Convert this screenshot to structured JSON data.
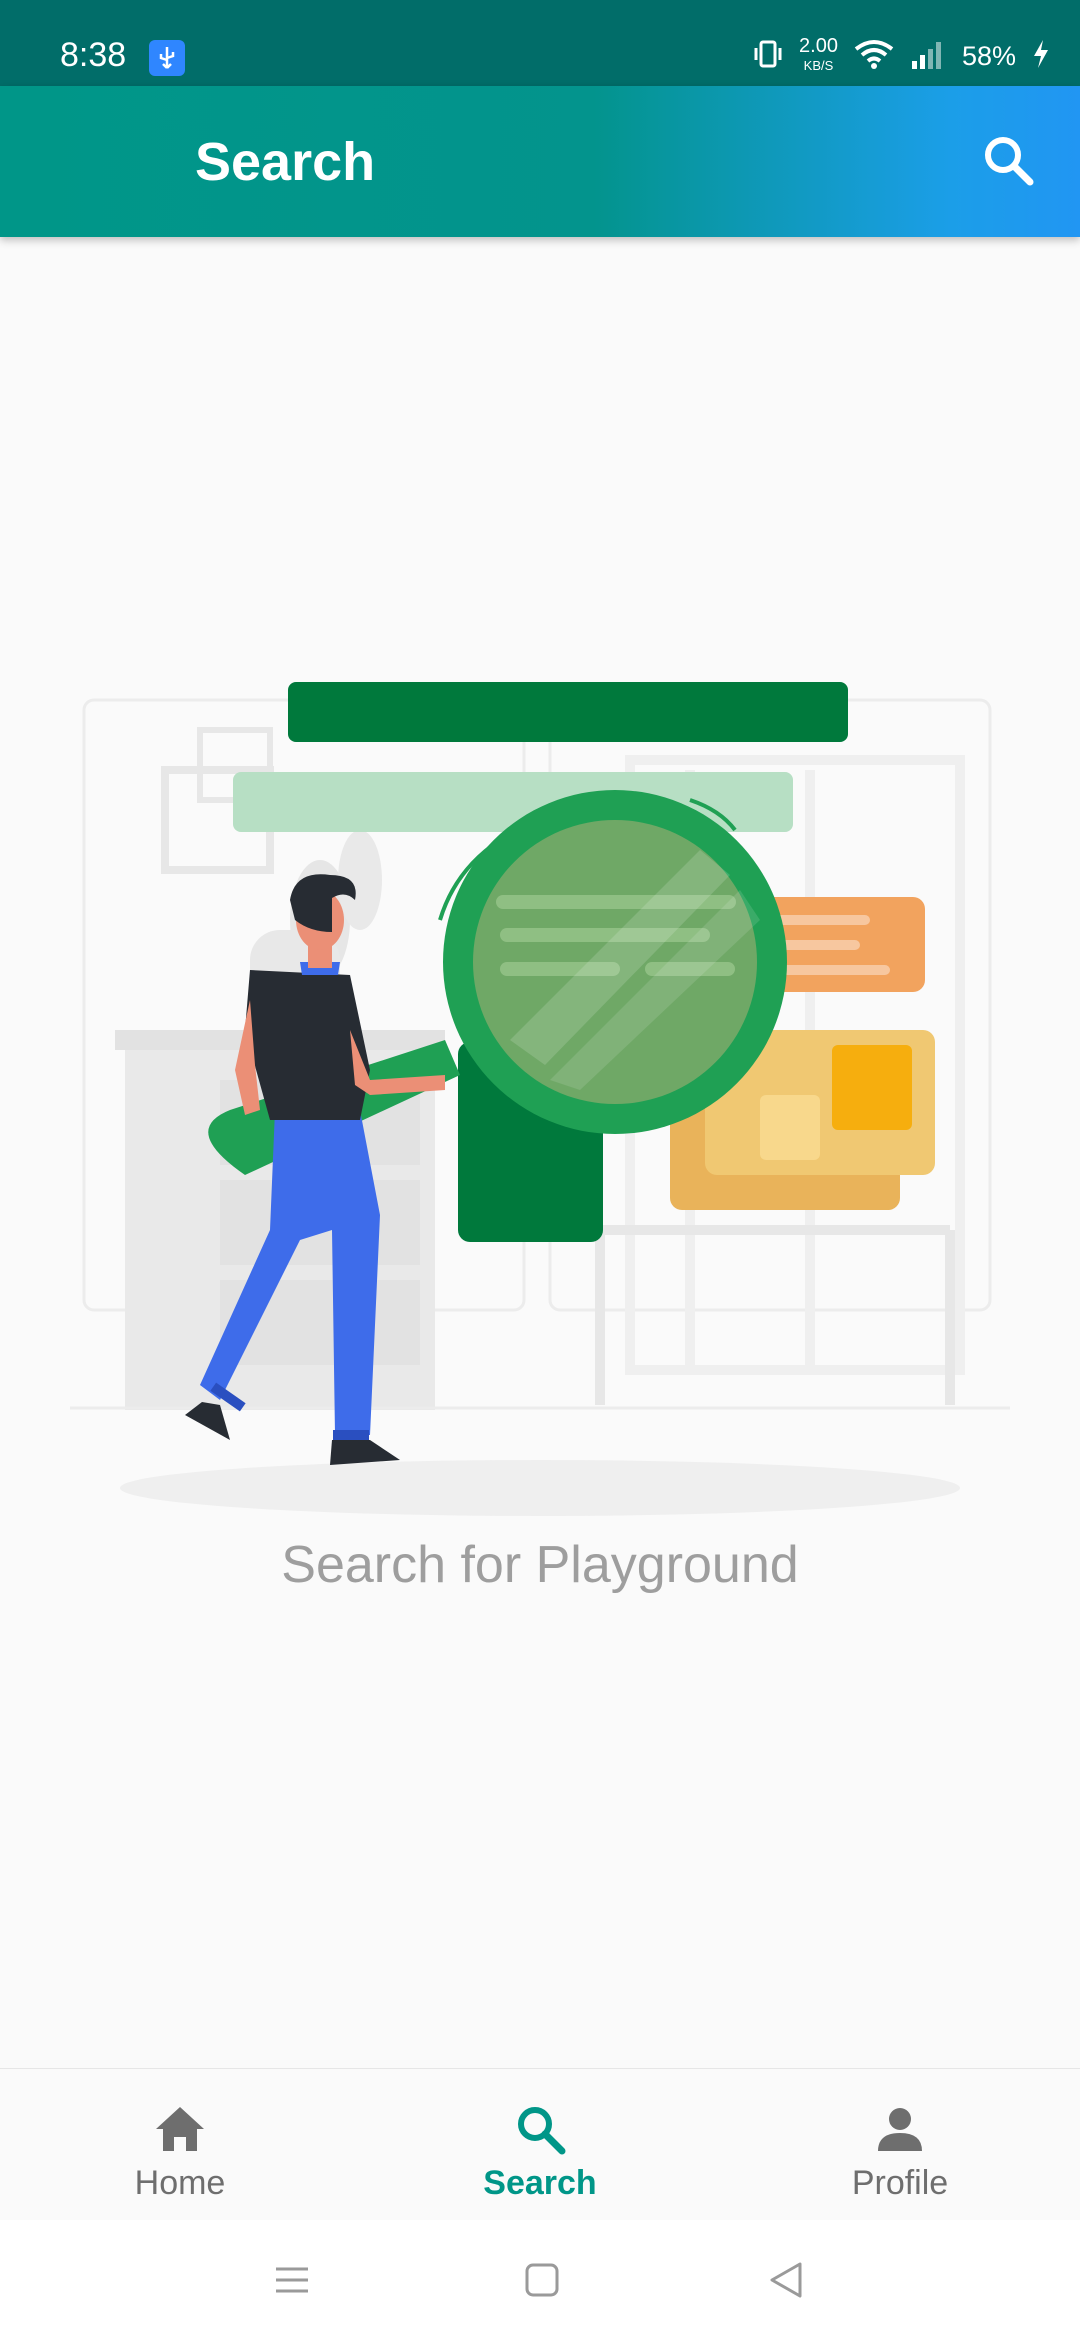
{
  "status_bar": {
    "time": "8:38",
    "net_speed_value": "2.00",
    "net_speed_unit": "KB/S",
    "battery": "58%"
  },
  "app_bar": {
    "title": "Search",
    "action_icon": "search-icon"
  },
  "main": {
    "empty_state_text": "Search for Playground",
    "illustration": "person-with-magnifier-illustration"
  },
  "bottom_nav": {
    "selected": "Search",
    "items": [
      {
        "label": "Home",
        "icon": "home-icon"
      },
      {
        "label": "Search",
        "icon": "search-icon"
      },
      {
        "label": "Profile",
        "icon": "person-icon"
      }
    ]
  },
  "system_nav": {
    "buttons": [
      "menu-icon",
      "home-square-icon",
      "back-triangle-icon"
    ]
  },
  "colors": {
    "primary": "#009688",
    "gradient_end": "#2196f3",
    "status_bar": "#016d69",
    "inactive_nav": "#6e6e6e",
    "hint_text": "#9e9e9e"
  }
}
